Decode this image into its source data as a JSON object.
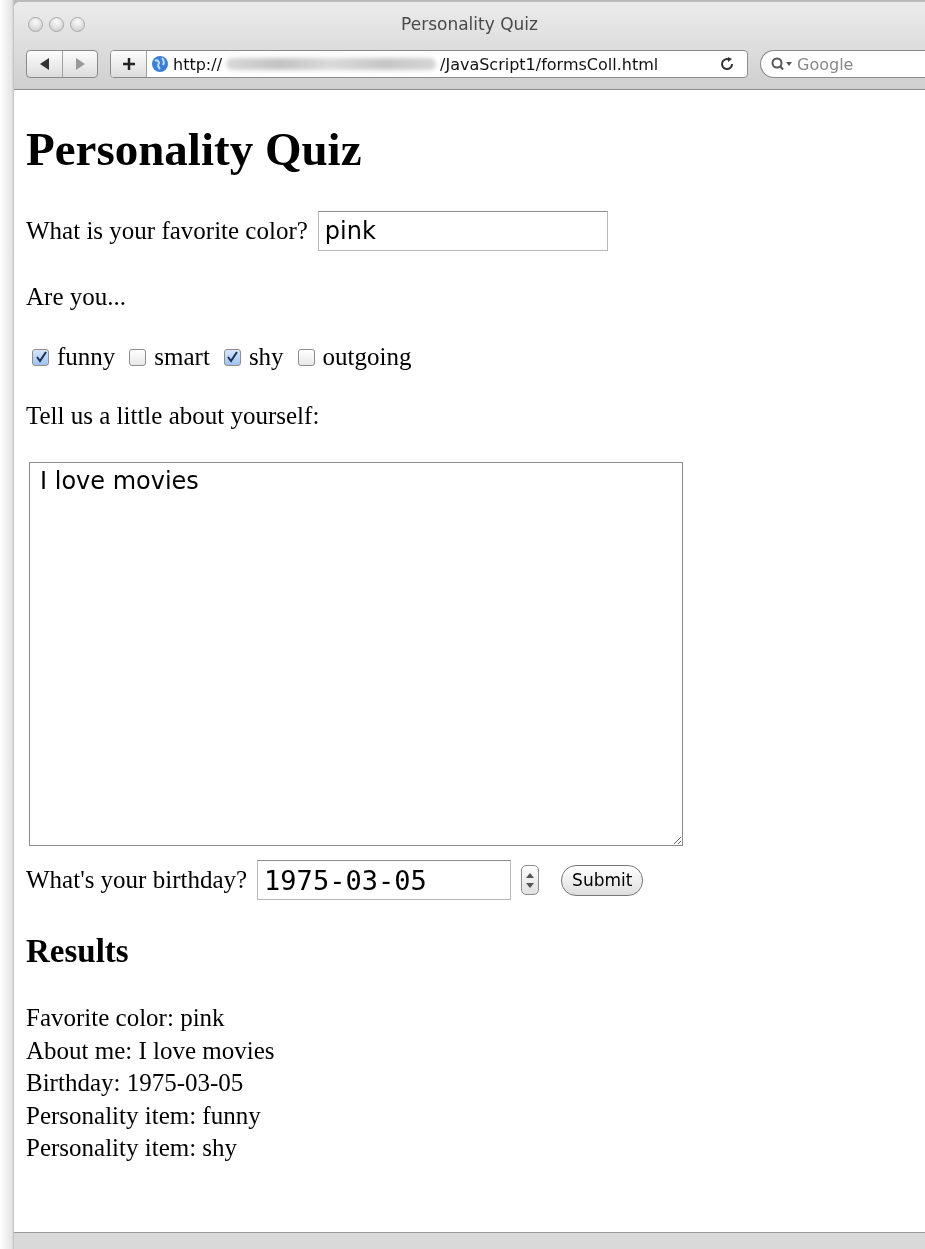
{
  "window": {
    "title": "Personality Quiz"
  },
  "toolbar": {
    "url_start": "http://",
    "url_end": "/JavaScript1/formsColl.html",
    "search_placeholder": "Google"
  },
  "page": {
    "heading": "Personality Quiz",
    "color_label": "What is your favorite color?",
    "color_value": "pink",
    "are_you": "Are you...",
    "traits": [
      {
        "label": "funny",
        "checked": true
      },
      {
        "label": "smart",
        "checked": false
      },
      {
        "label": "shy",
        "checked": true
      },
      {
        "label": "outgoing",
        "checked": false
      }
    ],
    "about_label": "Tell us a little about yourself:",
    "about_value": "I love movies",
    "birthday_label": "What's your birthday?",
    "birthday_value": "1975-03-05",
    "submit": "Submit",
    "results_heading": "Results",
    "results": [
      "Favorite color: pink",
      "About me: I love movies",
      "Birthday: 1975-03-05",
      "Personality item: funny",
      "Personality item: shy"
    ]
  }
}
